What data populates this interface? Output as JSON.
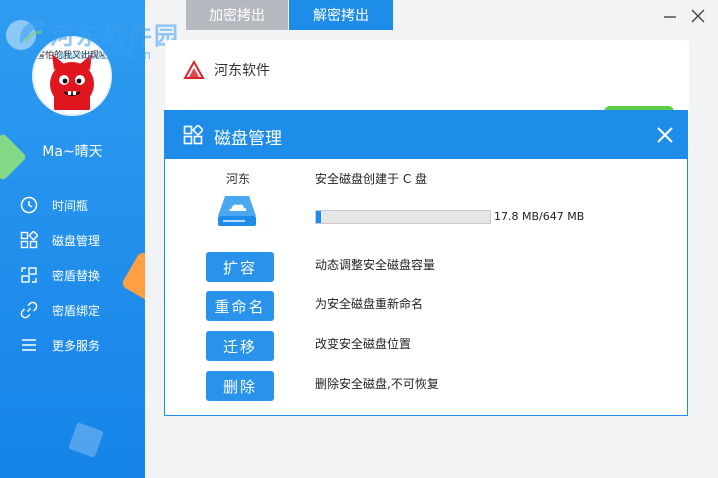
{
  "watermark": {
    "text": "河东软件园",
    "url": "www.pc0359.cn"
  },
  "sidebar": {
    "avatar_caption": "害怕的我又出现啦",
    "username": "Ma~晴天",
    "items": [
      {
        "label": "时间瓶",
        "icon": "clock-icon"
      },
      {
        "label": "磁盘管理",
        "icon": "disk-management-icon"
      },
      {
        "label": "密盾替换",
        "icon": "shield-swap-icon"
      },
      {
        "label": "密盾绑定",
        "icon": "link-icon"
      },
      {
        "label": "更多服务",
        "icon": "menu-icon"
      }
    ]
  },
  "tabs": [
    {
      "label": "加密拷出",
      "active": false
    },
    {
      "label": "解密拷出",
      "active": true
    }
  ],
  "background_card": {
    "title": "河东软件"
  },
  "dialog": {
    "title": "磁盘管理",
    "disk_name": "河东",
    "disk_description": "安全磁盘创建于 C 盘",
    "usage_text": "17.8 MB/647 MB",
    "usage_fraction": 0.0275,
    "actions": [
      {
        "label": "扩容",
        "description": "动态调整安全磁盘容量"
      },
      {
        "label": "重命名",
        "description": "为安全磁盘重新命名"
      },
      {
        "label": "迁移",
        "description": "改变安全磁盘位置"
      },
      {
        "label": "删除",
        "description": "删除安全磁盘,不可恢复"
      }
    ]
  },
  "colors": {
    "primary": "#1e8de9",
    "sidebar": "#2f9cf2",
    "tab_inactive": "#b6b9bf"
  }
}
